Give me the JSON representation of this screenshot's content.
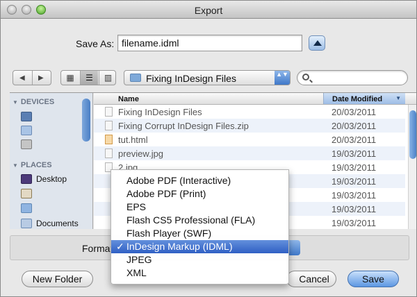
{
  "window": {
    "title": "Export"
  },
  "save_as": {
    "label": "Save As:",
    "value": "filename.idml"
  },
  "toolbar": {
    "back_glyph": "◀",
    "forward_glyph": "▶",
    "location": "Fixing InDesign Files",
    "location_arrows": "▲▼",
    "search_placeholder": ""
  },
  "sidebar": {
    "devices_heading": "DEVICES",
    "places_heading": "PLACES",
    "places": [
      {
        "label": "Desktop",
        "icon": "desktop-icon"
      },
      {
        "label": "",
        "icon": "home-icon"
      },
      {
        "label": "",
        "icon": "folder-icon"
      },
      {
        "label": "Documents",
        "icon": "documents-icon"
      }
    ]
  },
  "file_list": {
    "col_name": "Name",
    "col_date": "Date Modified",
    "rows": [
      {
        "name": "Fixing InDesign Files",
        "date": "20/03/2011"
      },
      {
        "name": "Fixing Corrupt InDesign Files.zip",
        "date": "20/03/2011"
      },
      {
        "name": "tut.html",
        "date": "20/03/2011"
      },
      {
        "name": "preview.jpg",
        "date": "19/03/2011"
      },
      {
        "name": "2.jpg",
        "date": "19/03/2011"
      },
      {
        "name": "",
        "date": "19/03/2011"
      },
      {
        "name": "",
        "date": "19/03/2011"
      },
      {
        "name": "",
        "date": "19/03/2011"
      },
      {
        "name": "",
        "date": "19/03/2011"
      }
    ]
  },
  "format": {
    "label": "Format",
    "selected": "InDesign Markup (IDML)",
    "options": [
      "Adobe PDF (Interactive)",
      "Adobe PDF (Print)",
      "EPS",
      "Flash CS5 Professional (FLA)",
      "Flash Player (SWF)",
      "InDesign Markup (IDML)",
      "JPEG",
      "XML"
    ],
    "check_glyph": "✓"
  },
  "buttons": {
    "new_folder": "New Folder",
    "cancel": "Cancel",
    "save": "Save"
  },
  "colors": {
    "accent": "#3f78c9",
    "selection": "#2f5fc4"
  }
}
